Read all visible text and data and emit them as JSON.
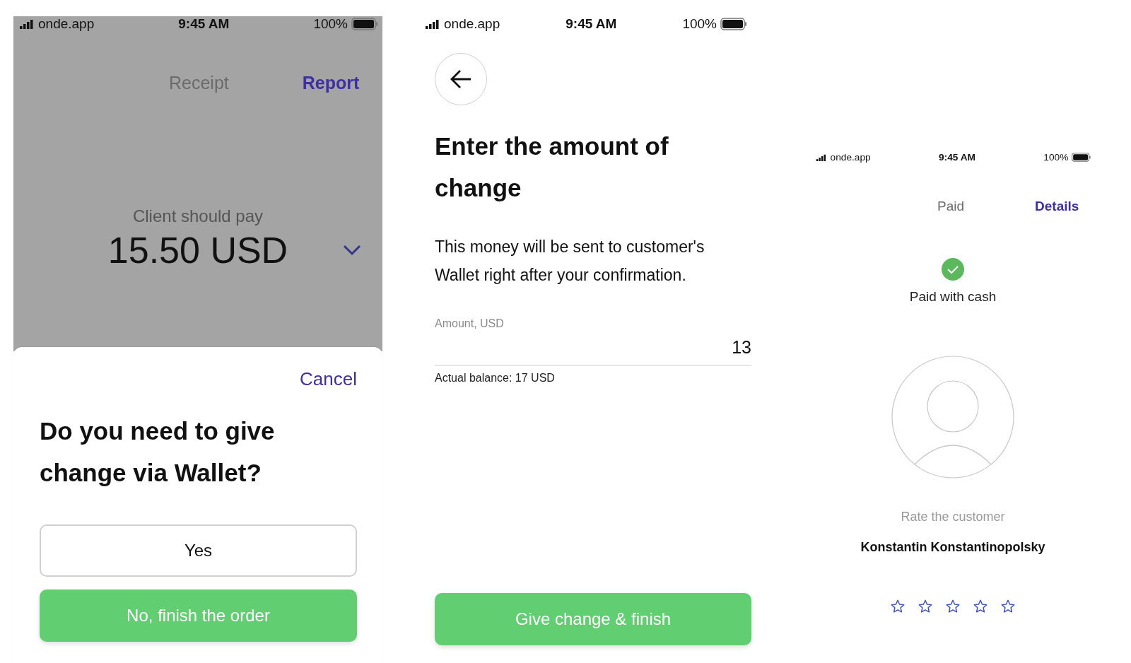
{
  "change_prompt": {
    "status_bar": {
      "carrier": "onde.app",
      "time": "9:45 AM",
      "battery": "100%"
    },
    "tabs": [
      {
        "label": "Receipt",
        "selected": false
      },
      {
        "label": "Report",
        "selected": true
      }
    ],
    "amount_label": "Client should pay",
    "amount": "15.50 USD",
    "sheet": {
      "cancel": "Cancel",
      "question": "Do you need to give change via Wallet?",
      "buttons": [
        {
          "label": "Yes",
          "kind": "outline"
        },
        {
          "label": "No, finish the order",
          "kind": "primary"
        }
      ]
    }
  },
  "change_amount": {
    "status_bar": {
      "carrier": "onde.app",
      "time": "9:45 AM",
      "battery": "100%"
    },
    "title": "Enter the amount of change",
    "description": "This money will be sent to customer's Wallet right after your confirmation.",
    "field": {
      "label": "Amount, USD",
      "value": "13"
    },
    "balance": "Actual balance: 17 USD",
    "button": {
      "label": "Give change & finish",
      "kind": "primary"
    }
  },
  "payment_done": {
    "status_bar": {
      "carrier": "onde.app",
      "time": "9:45 AM",
      "battery": "100%"
    },
    "tabs": [
      {
        "label": "Paid",
        "selected": false
      },
      {
        "label": "Details",
        "selected": true
      }
    ],
    "status": "Paid with cash",
    "rate_label": "Rate the customer",
    "customer": "Konstantin Konstantinopolsky",
    "stars": 0
  }
}
